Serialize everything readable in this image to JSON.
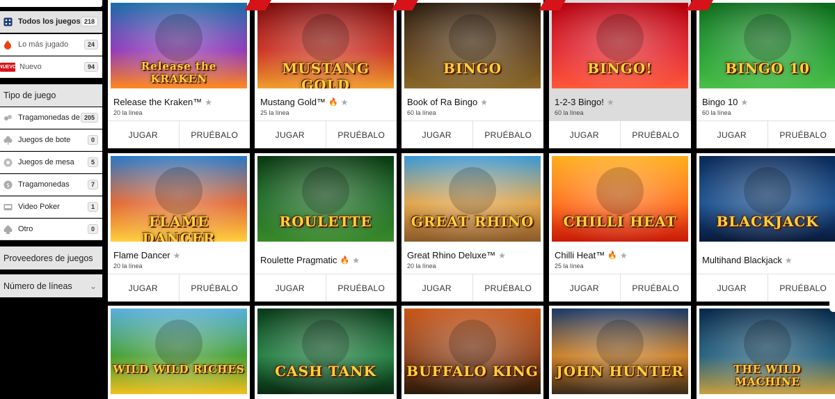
{
  "sidebar": {
    "items": [
      {
        "label": "Todos los juegos",
        "count": "218",
        "icon": "dice-icon"
      },
      {
        "label": "Lo más jugado",
        "count": "24",
        "icon": "fire-icon"
      },
      {
        "label": "Nuevo",
        "count": "94",
        "icon": "new-badge",
        "badge": "NUEVO"
      }
    ],
    "game_type_title": "Tipo de juego",
    "game_types": [
      {
        "label": "Tragamonedas de",
        "count": "205",
        "icon": "slots-icon"
      },
      {
        "label": "Juegos de bote",
        "count": "0",
        "icon": "clover-icon"
      },
      {
        "label": "Juegos de mesa",
        "count": "5",
        "icon": "table-icon"
      },
      {
        "label": "Tragamonedas",
        "count": "7",
        "icon": "coin-icon"
      },
      {
        "label": "Video Poker",
        "count": "1",
        "icon": "poker-icon"
      },
      {
        "label": "Otro",
        "count": "0",
        "icon": "spade-icon"
      }
    ],
    "providers_title": "Proveedores de juegos",
    "lines_title": "Número de líneas"
  },
  "buttons": {
    "play": "JUGAR",
    "try": "PRUÉBALO"
  },
  "games": [
    {
      "name": "Release the Kraken™",
      "lines": "20 la línea",
      "hot": false,
      "art": "Release the KRAKEN",
      "colors": [
        "#1b6fa8",
        "#8a2fb5",
        "#ff8a1f"
      ]
    },
    {
      "name": "Mustang Gold™",
      "lines": "25 la línea",
      "hot": true,
      "art": "MUSTANG GOLD",
      "colors": [
        "#7a0a0a",
        "#c8281a",
        "#f0a030"
      ]
    },
    {
      "name": "Book of Ra Bingo",
      "lines": "60 la línea",
      "hot": false,
      "art": "BINGO",
      "colors": [
        "#2a1a0c",
        "#5a3a14",
        "#8c6a2a"
      ]
    },
    {
      "name": "1-2-3 Bingo!",
      "lines": "60 la línea",
      "hot": false,
      "art": "BINGO!",
      "colors": [
        "#b3000d",
        "#e0202a",
        "#ff5a3a"
      ]
    },
    {
      "name": "Bingo 10",
      "lines": "60 la línea",
      "hot": false,
      "art": "BINGO 10",
      "colors": [
        "#0c6a1a",
        "#1c9a2a",
        "#4cc04a"
      ]
    },
    {
      "name": "Flame Dancer",
      "lines": "20 la línea",
      "hot": false,
      "art": "FLAME DANCER",
      "colors": [
        "#2a7ac8",
        "#e0602a",
        "#ffd040"
      ]
    },
    {
      "name": "Roulette Pragmatic",
      "lines": "",
      "hot": true,
      "art": "ROULETTE",
      "colors": [
        "#0a3a12",
        "#1a6a22",
        "#3a8a2a"
      ]
    },
    {
      "name": "Great Rhino Deluxe™",
      "lines": "20 la línea",
      "hot": false,
      "art": "GREAT RHINO",
      "colors": [
        "#3a9ad8",
        "#e0a040",
        "#8a5a2a"
      ]
    },
    {
      "name": "Chilli Heat™",
      "lines": "25 la línea",
      "hot": true,
      "art": "CHILLI HEAT",
      "colors": [
        "#ffb020",
        "#ff6a10",
        "#c81a0a"
      ]
    },
    {
      "name": "Multihand Blackjack",
      "lines": "",
      "hot": false,
      "art": "BLACKJACK",
      "colors": [
        "#0a2a5a",
        "#124a8a",
        "#0a1a3a"
      ]
    },
    {
      "name": "",
      "lines": "",
      "hot": false,
      "art": "WILD WILD RICHES",
      "colors": [
        "#5ab0e0",
        "#3a9a2a",
        "#f0c020"
      ]
    },
    {
      "name": "",
      "lines": "",
      "hot": false,
      "art": "CASH TANK",
      "colors": [
        "#0a3a1a",
        "#1a7a3a",
        "#0a2a12"
      ]
    },
    {
      "name": "",
      "lines": "",
      "hot": false,
      "art": "BUFFALO KING",
      "colors": [
        "#c8581a",
        "#8a3a12",
        "#2a1a0a"
      ]
    },
    {
      "name": "",
      "lines": "",
      "hot": false,
      "art": "JOHN HUNTER",
      "colors": [
        "#1a3a6a",
        "#c8781a",
        "#3a2a1a"
      ]
    },
    {
      "name": "",
      "lines": "",
      "hot": false,
      "art": "THE WILD MACHINE",
      "colors": [
        "#0a2a4a",
        "#1a5a7a",
        "#c8a040"
      ]
    }
  ]
}
